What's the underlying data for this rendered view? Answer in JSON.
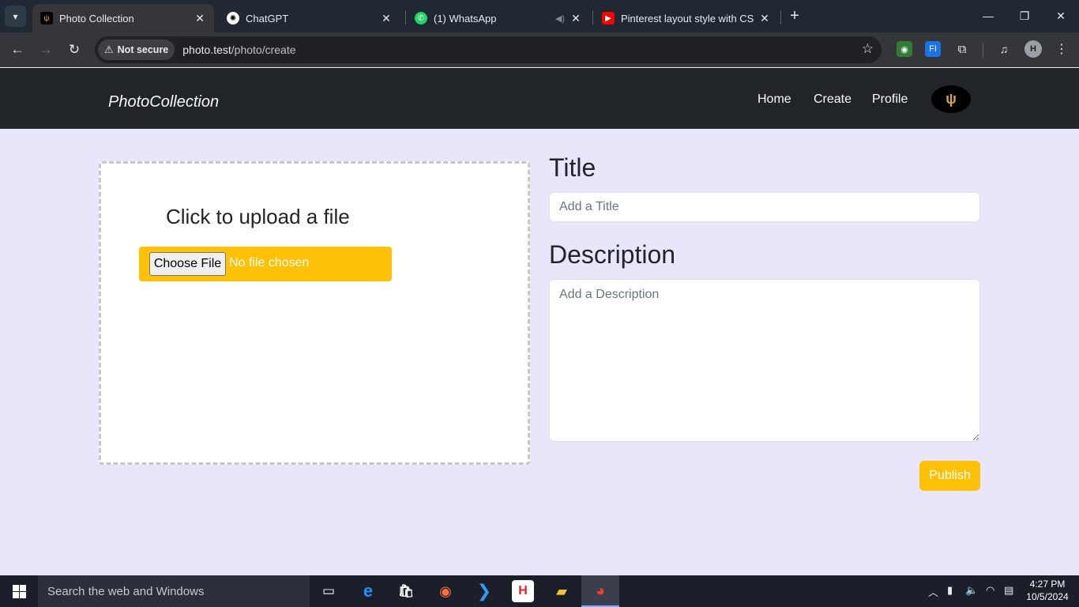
{
  "browser": {
    "tabs": [
      {
        "title": "Photo Collection",
        "active": true
      },
      {
        "title": "ChatGPT",
        "active": false
      },
      {
        "title": "(1) WhatsApp",
        "active": false
      },
      {
        "title": "Pinterest layout style with CSS |",
        "active": false
      }
    ],
    "security_label": "Not secure",
    "url_host": "photo.test",
    "url_path": "/photo/create",
    "profile_initial": "H"
  },
  "navbar": {
    "brand": "PhotoCollection",
    "links": [
      "Home",
      "Create",
      "Profile"
    ]
  },
  "upload": {
    "title": "Click to upload a file",
    "choose_label": "Choose File",
    "status": "No file chosen"
  },
  "form": {
    "title_label": "Title",
    "title_placeholder": "Add a Title",
    "description_label": "Description",
    "description_placeholder": "Add a Description",
    "publish_label": "Publish"
  },
  "taskbar": {
    "search_placeholder": "Search the web and Windows",
    "time": "4:27 PM",
    "date": "10/5/2024"
  },
  "colors": {
    "accent": "#ffc107",
    "navbar_bg": "#212529",
    "page_bg": "#e9e6fc"
  }
}
